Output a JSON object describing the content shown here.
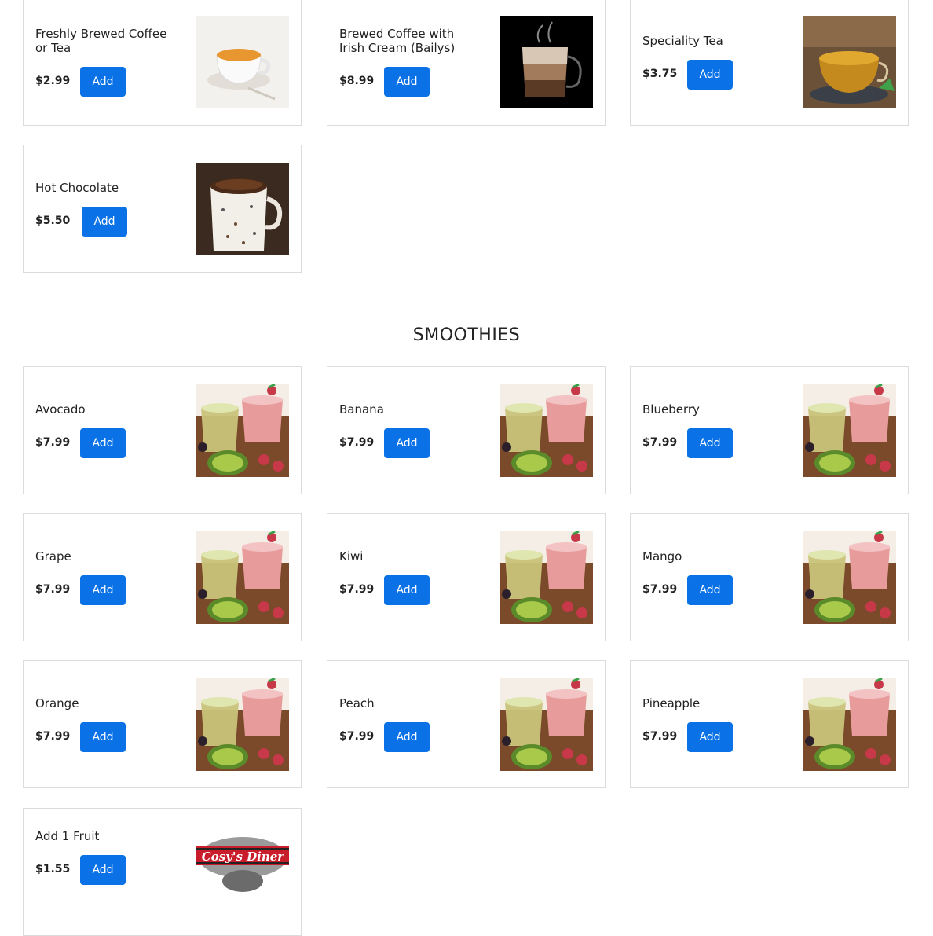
{
  "drinks": [
    {
      "name": "Freshly Brewed Coffee or Tea",
      "price": "$2.99",
      "add": "Add",
      "image": "coffee-cup-image"
    },
    {
      "name": "Brewed Coffee with Irish Cream (Bailys)",
      "price": "$8.99",
      "add": "Add",
      "image": "latte-glass-image"
    },
    {
      "name": "Speciality Tea",
      "price": "$3.75",
      "add": "Add",
      "image": "tea-cup-image"
    },
    {
      "name": "Hot Chocolate",
      "price": "$5.50",
      "add": "Add",
      "image": "hot-chocolate-image"
    }
  ],
  "smoothies_title": "SMOOTHIES",
  "smoothies": [
    {
      "name": "Avocado",
      "price": "$7.99",
      "add": "Add"
    },
    {
      "name": "Banana",
      "price": "$7.99",
      "add": "Add"
    },
    {
      "name": "Blueberry",
      "price": "$7.99",
      "add": "Add"
    },
    {
      "name": "Grape",
      "price": "$7.99",
      "add": "Add"
    },
    {
      "name": "Kiwi",
      "price": "$7.99",
      "add": "Add"
    },
    {
      "name": "Mango",
      "price": "$7.99",
      "add": "Add"
    },
    {
      "name": "Orange",
      "price": "$7.99",
      "add": "Add"
    },
    {
      "name": "Peach",
      "price": "$7.99",
      "add": "Add"
    },
    {
      "name": "Pineapple",
      "price": "$7.99",
      "add": "Add"
    },
    {
      "name": "Add 1 Fruit",
      "price": "$1.55",
      "add": "Add",
      "logo_text": "Cosy's Diner"
    }
  ],
  "colors": {
    "accent": "#0a72e6",
    "border": "#dcdcdc"
  }
}
